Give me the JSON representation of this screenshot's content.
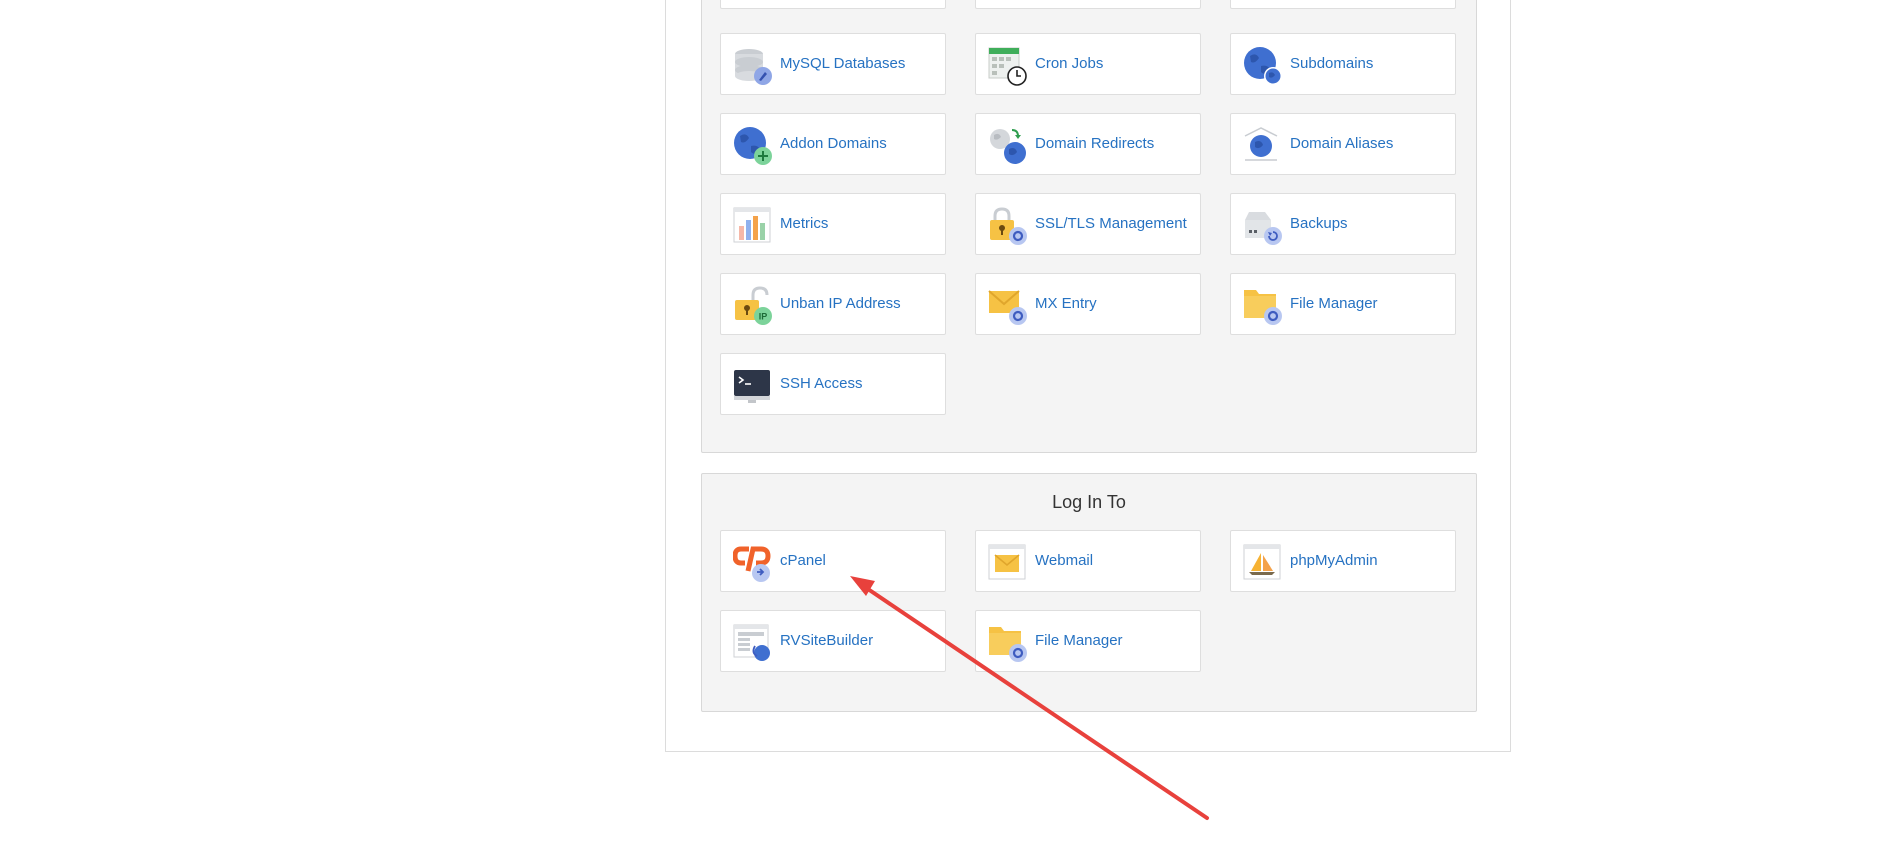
{
  "tools": {
    "tiles": [
      {
        "label": "MySQL Databases",
        "icon": "database-icon"
      },
      {
        "label": "Cron Jobs",
        "icon": "calendar-clock-icon"
      },
      {
        "label": "Subdomains",
        "icon": "globe-icon"
      },
      {
        "label": "Addon Domains",
        "icon": "globe-add-icon"
      },
      {
        "label": "Domain Redirects",
        "icon": "domain-redirect-icon"
      },
      {
        "label": "Domain Aliases",
        "icon": "domain-alias-icon"
      },
      {
        "label": "Metrics",
        "icon": "bar-chart-icon"
      },
      {
        "label": "SSL/TLS Management",
        "icon": "padlock-gear-icon"
      },
      {
        "label": "Backups",
        "icon": "backup-drive-icon"
      },
      {
        "label": "Unban IP Address",
        "icon": "unlock-ip-icon"
      },
      {
        "label": "MX Entry",
        "icon": "envelope-gear-icon"
      },
      {
        "label": "File Manager",
        "icon": "folder-gear-icon"
      },
      {
        "label": "SSH Access",
        "icon": "terminal-icon"
      }
    ]
  },
  "login": {
    "title": "Log In To",
    "tiles": [
      {
        "label": "cPanel",
        "icon": "cpanel-logo-icon"
      },
      {
        "label": "Webmail",
        "icon": "webmail-envelope-icon"
      },
      {
        "label": "phpMyAdmin",
        "icon": "phpmyadmin-sailboat-icon"
      },
      {
        "label": "RVSiteBuilder",
        "icon": "sitebuilder-icon"
      },
      {
        "label": "File Manager",
        "icon": "folder-gear-icon"
      }
    ]
  },
  "colors": {
    "link": "#2672c2",
    "annotation_arrow": "#e8413c"
  }
}
